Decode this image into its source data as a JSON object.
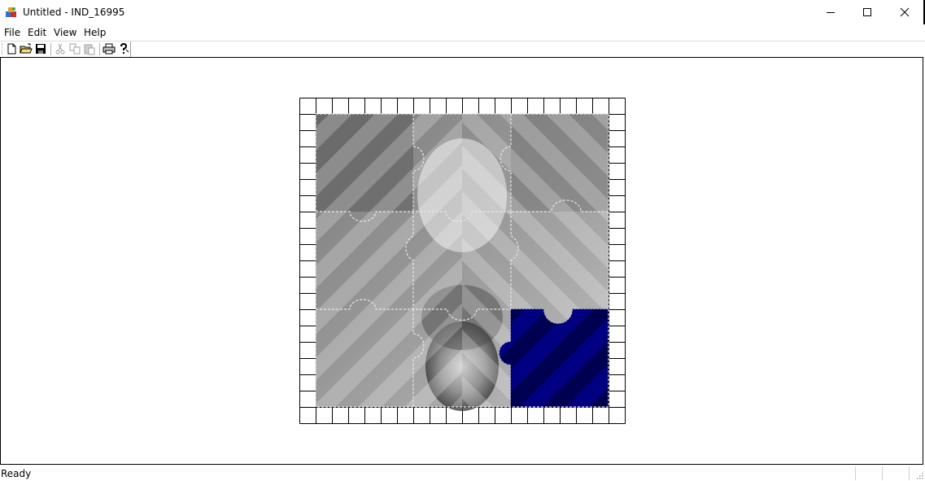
{
  "window": {
    "title": "Untitled - IND_16995"
  },
  "menu": {
    "items": [
      {
        "label": "File"
      },
      {
        "label": "Edit"
      },
      {
        "label": "View"
      },
      {
        "label": "Help"
      }
    ]
  },
  "toolbar": {
    "buttons": [
      {
        "icon": "new-file-icon",
        "enabled": true
      },
      {
        "icon": "open-folder-icon",
        "enabled": true
      },
      {
        "icon": "save-icon",
        "enabled": true
      },
      {
        "icon": "cut-icon",
        "enabled": false
      },
      {
        "icon": "copy-icon",
        "enabled": false
      },
      {
        "icon": "paste-icon",
        "enabled": false
      },
      {
        "icon": "print-icon",
        "enabled": true
      },
      {
        "icon": "help-icon",
        "enabled": true
      }
    ]
  },
  "puzzle": {
    "grid_cells": 20,
    "pieces_grid": "3x3",
    "missing_piece_color": "#000080",
    "empty_slot": "bottom-right"
  },
  "status": {
    "text": "Ready"
  }
}
